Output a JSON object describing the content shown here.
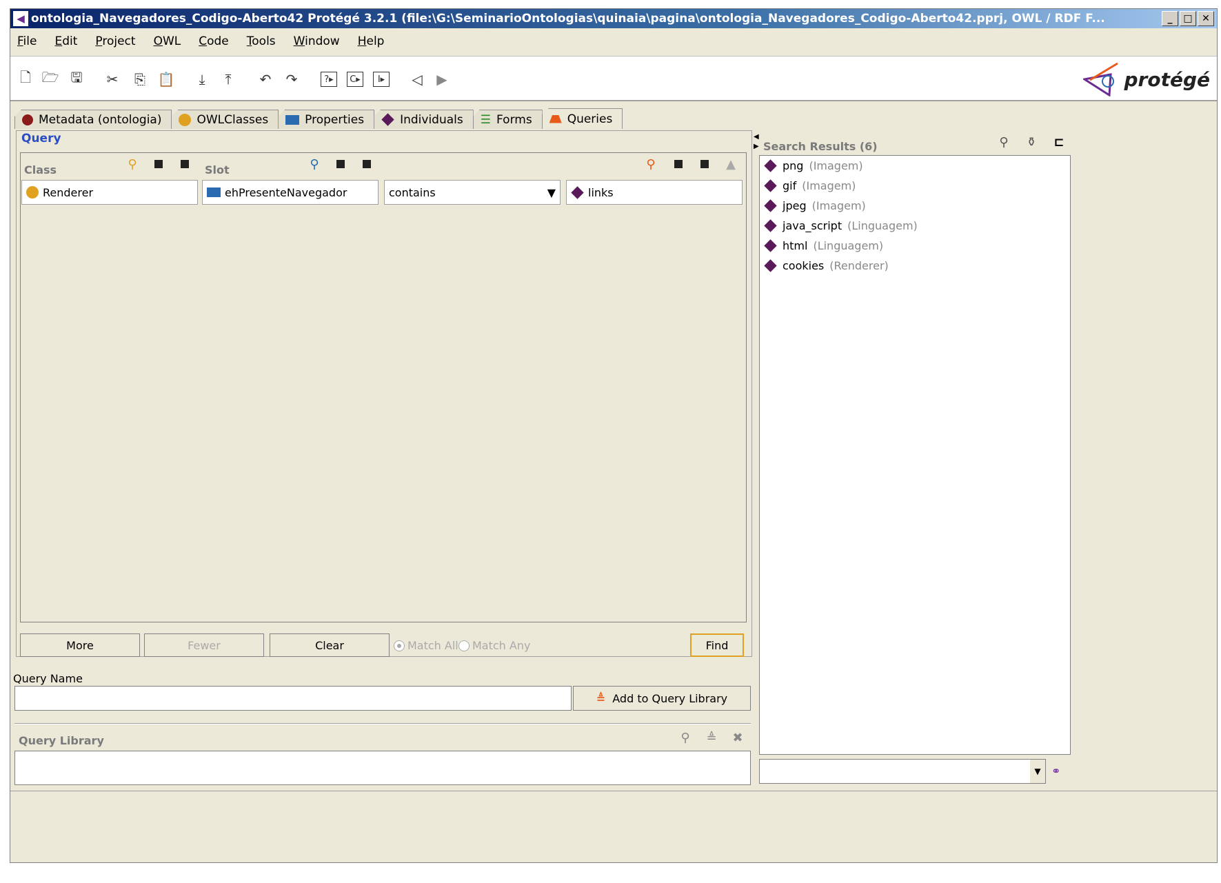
{
  "window": {
    "title": "ontologia_Navegadores_Codigo-Aberto42  Protégé 3.2.1     (file:\\G:\\SeminarioOntologias\\quinaia\\pagina\\ontologia_Navegadores_Codigo-Aberto42.pprj, OWL / RDF F..."
  },
  "menu": [
    "File",
    "Edit",
    "Project",
    "OWL",
    "Code",
    "Tools",
    "Window",
    "Help"
  ],
  "logo_text": "protégé",
  "tabs": [
    {
      "label": "Metadata (ontologia)",
      "icon": "red-circle-icon",
      "color": "#8b1a1a"
    },
    {
      "label": "OWLClasses",
      "icon": "yellow-circle-icon",
      "color": "#e0a020"
    },
    {
      "label": "Properties",
      "icon": "blue-rect-icon",
      "color": "#2a6ab0"
    },
    {
      "label": "Individuals",
      "icon": "purple-diamond-icon",
      "color": "#5a1a5a"
    },
    {
      "label": "Forms",
      "icon": "green-form-icon",
      "color": "#2a8a2a"
    },
    {
      "label": "Queries",
      "icon": "orange-query-icon",
      "color": "#e85a1a"
    }
  ],
  "query": {
    "title": "Query",
    "class_header": "Class",
    "slot_header": "Slot",
    "class_value": "Renderer",
    "slot_value": "ehPresenteNavegador",
    "operator": "contains",
    "value": "links",
    "buttons": {
      "more": "More",
      "fewer": "Fewer",
      "clear": "Clear",
      "find": "Find"
    },
    "match_all": "Match All",
    "match_any": "Match Any",
    "query_name_label": "Query Name",
    "query_name_value": "",
    "add_library": "Add to Query Library",
    "library_label": "Query Library"
  },
  "search_results": {
    "label": "Search Results (6)",
    "items": [
      {
        "name": "png",
        "type": "(Imagem)"
      },
      {
        "name": "gif",
        "type": "(Imagem)"
      },
      {
        "name": "jpeg",
        "type": "(Imagem)"
      },
      {
        "name": "java_script",
        "type": "(Linguagem)"
      },
      {
        "name": "html",
        "type": "(Linguagem)"
      },
      {
        "name": "cookies",
        "type": "(Renderer)"
      }
    ]
  },
  "colors": {
    "individual": "#5a1a5a",
    "class": "#e0a020",
    "property": "#2a6ab0",
    "query_title": "#2a4ec8"
  }
}
